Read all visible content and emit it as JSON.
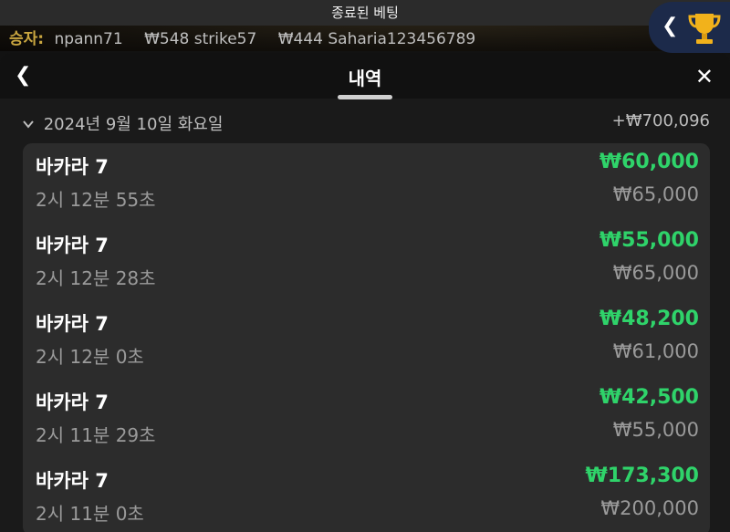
{
  "banner": {
    "text": "종료된 베팅"
  },
  "winners": {
    "label": "승자:",
    "entries": [
      "npann71",
      "₩548 strike57",
      "₩444 Saharia123456789"
    ]
  },
  "panel": {
    "back_icon": "chevron-left-icon",
    "title": "내역",
    "close_icon": "close-icon"
  },
  "history": {
    "date": "2024년 9월 10일 화요일",
    "total": "+₩700,096",
    "items": [
      {
        "game": "바카라 7",
        "time": "2시 12분 55초",
        "win": "₩60,000",
        "stake": "₩65,000"
      },
      {
        "game": "바카라 7",
        "time": "2시 12분 28초",
        "win": "₩55,000",
        "stake": "₩65,000"
      },
      {
        "game": "바카라 7",
        "time": "2시 12분 0초",
        "win": "₩48,200",
        "stake": "₩61,000"
      },
      {
        "game": "바카라 7",
        "time": "2시 11분 29초",
        "win": "₩42,500",
        "stake": "₩55,000"
      },
      {
        "game": "바카라 7",
        "time": "2시 11분 0초",
        "win": "₩173,300",
        "stake": "₩200,000"
      }
    ]
  },
  "colors": {
    "win": "#2fd36a",
    "accent": "#c9a640",
    "trophy": "#f2b21b"
  }
}
